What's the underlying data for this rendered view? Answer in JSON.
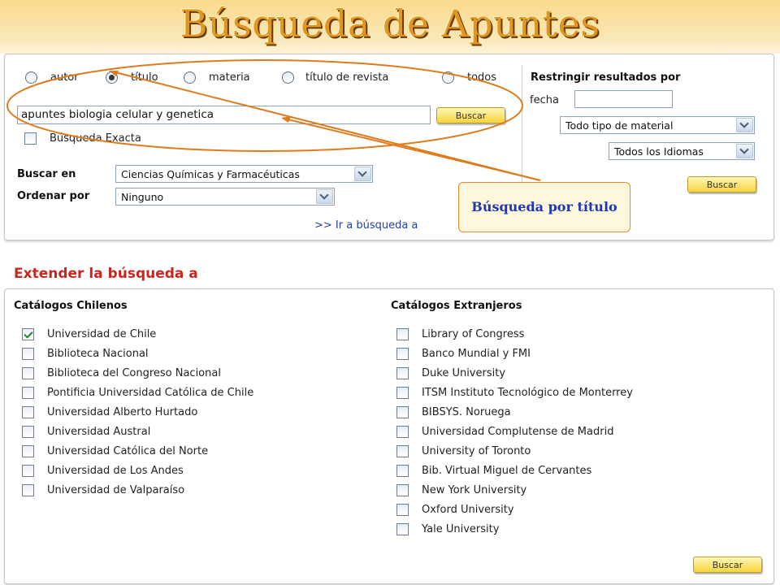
{
  "banner": {
    "title": "Búsqueda de Apuntes"
  },
  "search": {
    "radios": [
      {
        "label": "autor",
        "selected": false
      },
      {
        "label": "título",
        "selected": true
      },
      {
        "label": "materia",
        "selected": false
      },
      {
        "label": "título de revista",
        "selected": false
      },
      {
        "label": "todos",
        "selected": false
      }
    ],
    "query_value": "apuntes biologia celular y genetica",
    "search_button": "Buscar",
    "exact_label": "Búsqueda Exacta",
    "exact_checked": false,
    "buscar_en_label": "Buscar en",
    "buscar_en_value": "Ciencias Químicas y Farmacéuticas",
    "ordenar_label": "Ordenar por",
    "ordenar_value": "Ninguno",
    "advanced_link": ">> Ir a búsqueda a"
  },
  "restrict": {
    "title": "Restringir resultados por",
    "fecha_label": "fecha",
    "fecha_value": "",
    "material_value": "Todo tipo de material",
    "idiomas_value": "Todos los Idiomas",
    "button": "Buscar"
  },
  "callout": {
    "text": "Búsqueda por título",
    "color": "#1f36b5"
  },
  "extend": {
    "title": "Extender la búsqueda a",
    "chilenos_title": "Catálogos Chilenos",
    "chilenos": [
      {
        "label": "Universidad de Chile",
        "checked": true
      },
      {
        "label": "Biblioteca Nacional",
        "checked": false
      },
      {
        "label": "Biblioteca del Congreso Nacional",
        "checked": false
      },
      {
        "label": "Pontificia Universidad Católica de Chile",
        "checked": false
      },
      {
        "label": "Universidad Alberto Hurtado",
        "checked": false
      },
      {
        "label": "Universidad Austral",
        "checked": false
      },
      {
        "label": "Universidad Católica del Norte",
        "checked": false
      },
      {
        "label": "Universidad de Los Andes",
        "checked": false
      },
      {
        "label": "Universidad de Valparaíso",
        "checked": false
      }
    ],
    "extranjeros_title": "Catálogos Extranjeros",
    "extranjeros": [
      {
        "label": "Library of Congress",
        "checked": false
      },
      {
        "label": "Banco Mundial y FMI",
        "checked": false
      },
      {
        "label": "Duke University",
        "checked": false
      },
      {
        "label": "ITSM Instituto Tecnológico de Monterrey",
        "checked": false
      },
      {
        "label": "BIBSYS. Noruega",
        "checked": false
      },
      {
        "label": "Universidad Complutense de Madrid",
        "checked": false
      },
      {
        "label": "University of Toronto",
        "checked": false
      },
      {
        "label": "Bib. Virtual Miguel de Cervantes",
        "checked": false
      },
      {
        "label": "New York University",
        "checked": false
      },
      {
        "label": "Oxford University",
        "checked": false
      },
      {
        "label": "Yale University",
        "checked": false
      }
    ],
    "button": "Buscar"
  }
}
